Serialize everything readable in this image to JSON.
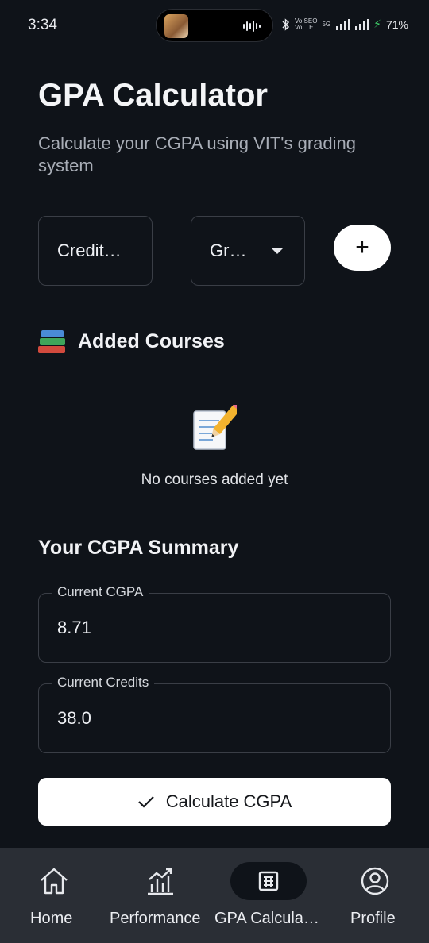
{
  "status_bar": {
    "time": "3:34",
    "volte_top": "Vo SEO",
    "volte_bottom": "VoLTE",
    "network": "5G",
    "battery": "71%"
  },
  "header": {
    "title": "GPA Calculator",
    "subtitle": "Calculate your CGPA using VIT's grading system"
  },
  "course_input": {
    "credits_placeholder": "Credit…",
    "grade_placeholder": "Gr…",
    "add_label": "+"
  },
  "added_courses": {
    "title": "Added Courses",
    "empty_text": "No courses added yet"
  },
  "summary": {
    "title": "Your CGPA Summary",
    "current_cgpa_label": "Current CGPA",
    "current_cgpa_value": "8.71",
    "current_credits_label": "Current Credits",
    "current_credits_value": "38.0",
    "calculate_label": "Calculate CGPA"
  },
  "bottom_nav": {
    "items": [
      {
        "label": "Home",
        "icon": "home-icon"
      },
      {
        "label": "Performance",
        "icon": "chart-icon"
      },
      {
        "label": "GPA Calcula…",
        "icon": "calculator-icon",
        "active": true
      },
      {
        "label": "Profile",
        "icon": "profile-icon"
      }
    ]
  },
  "colors": {
    "background": "#0f1319",
    "nav_background": "#2a2e35",
    "button": "#ffffff",
    "charging": "#3fd36b"
  }
}
